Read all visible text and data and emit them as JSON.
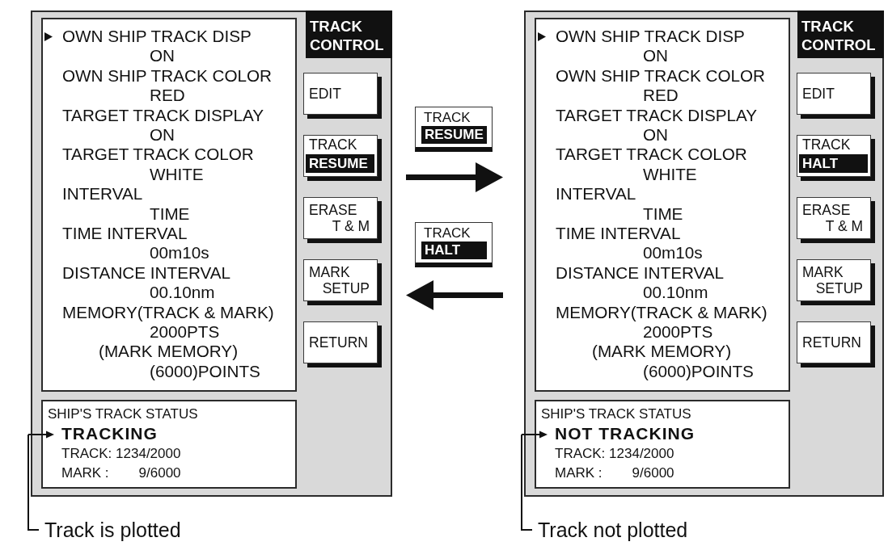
{
  "screens": [
    {
      "title": "TRACK CONTROL",
      "menu": [
        {
          "kind": "setting",
          "label": "OWN SHIP TRACK DISP",
          "value": "ON",
          "selected": true
        },
        {
          "kind": "setting",
          "label": "OWN SHIP TRACK COLOR",
          "value": "RED",
          "selected": false
        },
        {
          "kind": "setting",
          "label": "TARGET TRACK DISPLAY",
          "value": "ON",
          "selected": false
        },
        {
          "kind": "setting",
          "label": "TARGET TRACK COLOR",
          "value": "WHITE",
          "selected": false
        },
        {
          "kind": "setting",
          "label": "INTERVAL",
          "value": "TIME",
          "selected": false
        },
        {
          "kind": "setting",
          "label": "TIME INTERVAL",
          "value": "00m10s",
          "selected": false
        },
        {
          "kind": "setting",
          "label": "DISTANCE INTERVAL",
          "value": "00.10nm",
          "selected": false
        },
        {
          "kind": "setting",
          "label": "MEMORY(TRACK & MARK)",
          "value": "2000PTS",
          "selected": false
        },
        {
          "kind": "sub_setting",
          "label": "(MARK MEMORY)",
          "value": "(6000)POINTS",
          "selected": false
        }
      ],
      "softkeys": [
        {
          "kind": "single",
          "lines": [
            "EDIT"
          ]
        },
        {
          "kind": "toggle",
          "label": "TRACK",
          "option": "RESUME"
        },
        {
          "kind": "double",
          "lines": [
            "ERASE",
            "T & M"
          ]
        },
        {
          "kind": "double",
          "lines": [
            "MARK",
            "SETUP"
          ]
        },
        {
          "kind": "single",
          "lines": [
            "RETURN"
          ]
        }
      ],
      "status": {
        "title": "SHIP'S TRACK STATUS",
        "state": "TRACKING",
        "track": "TRACK: 1234/2000",
        "mark_label": "MARK :",
        "mark_value": "9/6000"
      },
      "caption": "Track is plotted"
    },
    {
      "title": "TRACK CONTROL",
      "menu": [
        {
          "kind": "setting",
          "label": "OWN SHIP TRACK DISP",
          "value": "ON",
          "selected": true
        },
        {
          "kind": "setting",
          "label": "OWN SHIP TRACK COLOR",
          "value": "RED",
          "selected": false
        },
        {
          "kind": "setting",
          "label": "TARGET TRACK DISPLAY",
          "value": "ON",
          "selected": false
        },
        {
          "kind": "setting",
          "label": "TARGET TRACK COLOR",
          "value": "WHITE",
          "selected": false
        },
        {
          "kind": "setting",
          "label": "INTERVAL",
          "value": "TIME",
          "selected": false
        },
        {
          "kind": "setting",
          "label": "TIME INTERVAL",
          "value": "00m10s",
          "selected": false
        },
        {
          "kind": "setting",
          "label": "DISTANCE INTERVAL",
          "value": "00.10nm",
          "selected": false
        },
        {
          "kind": "setting",
          "label": "MEMORY(TRACK & MARK)",
          "value": "2000PTS",
          "selected": false
        },
        {
          "kind": "sub_setting",
          "label": "(MARK MEMORY)",
          "value": "(6000)POINTS",
          "selected": false
        }
      ],
      "softkeys": [
        {
          "kind": "single",
          "lines": [
            "EDIT"
          ]
        },
        {
          "kind": "toggle",
          "label": "TRACK",
          "option": "HALT"
        },
        {
          "kind": "double",
          "lines": [
            "ERASE",
            "T & M"
          ]
        },
        {
          "kind": "double",
          "lines": [
            "MARK",
            "SETUP"
          ]
        },
        {
          "kind": "single",
          "lines": [
            "RETURN"
          ]
        }
      ],
      "status": {
        "title": "SHIP'S TRACK STATUS",
        "state": "NOT TRACKING",
        "track": "TRACK: 1234/2000",
        "mark_label": "MARK :",
        "mark_value": "9/6000"
      },
      "caption": "Track not plotted"
    }
  ],
  "transitions": [
    {
      "kind": "forward",
      "key_label": "TRACK",
      "key_option": "RESUME"
    },
    {
      "kind": "back",
      "key_label": "TRACK",
      "key_option": "HALT"
    }
  ]
}
